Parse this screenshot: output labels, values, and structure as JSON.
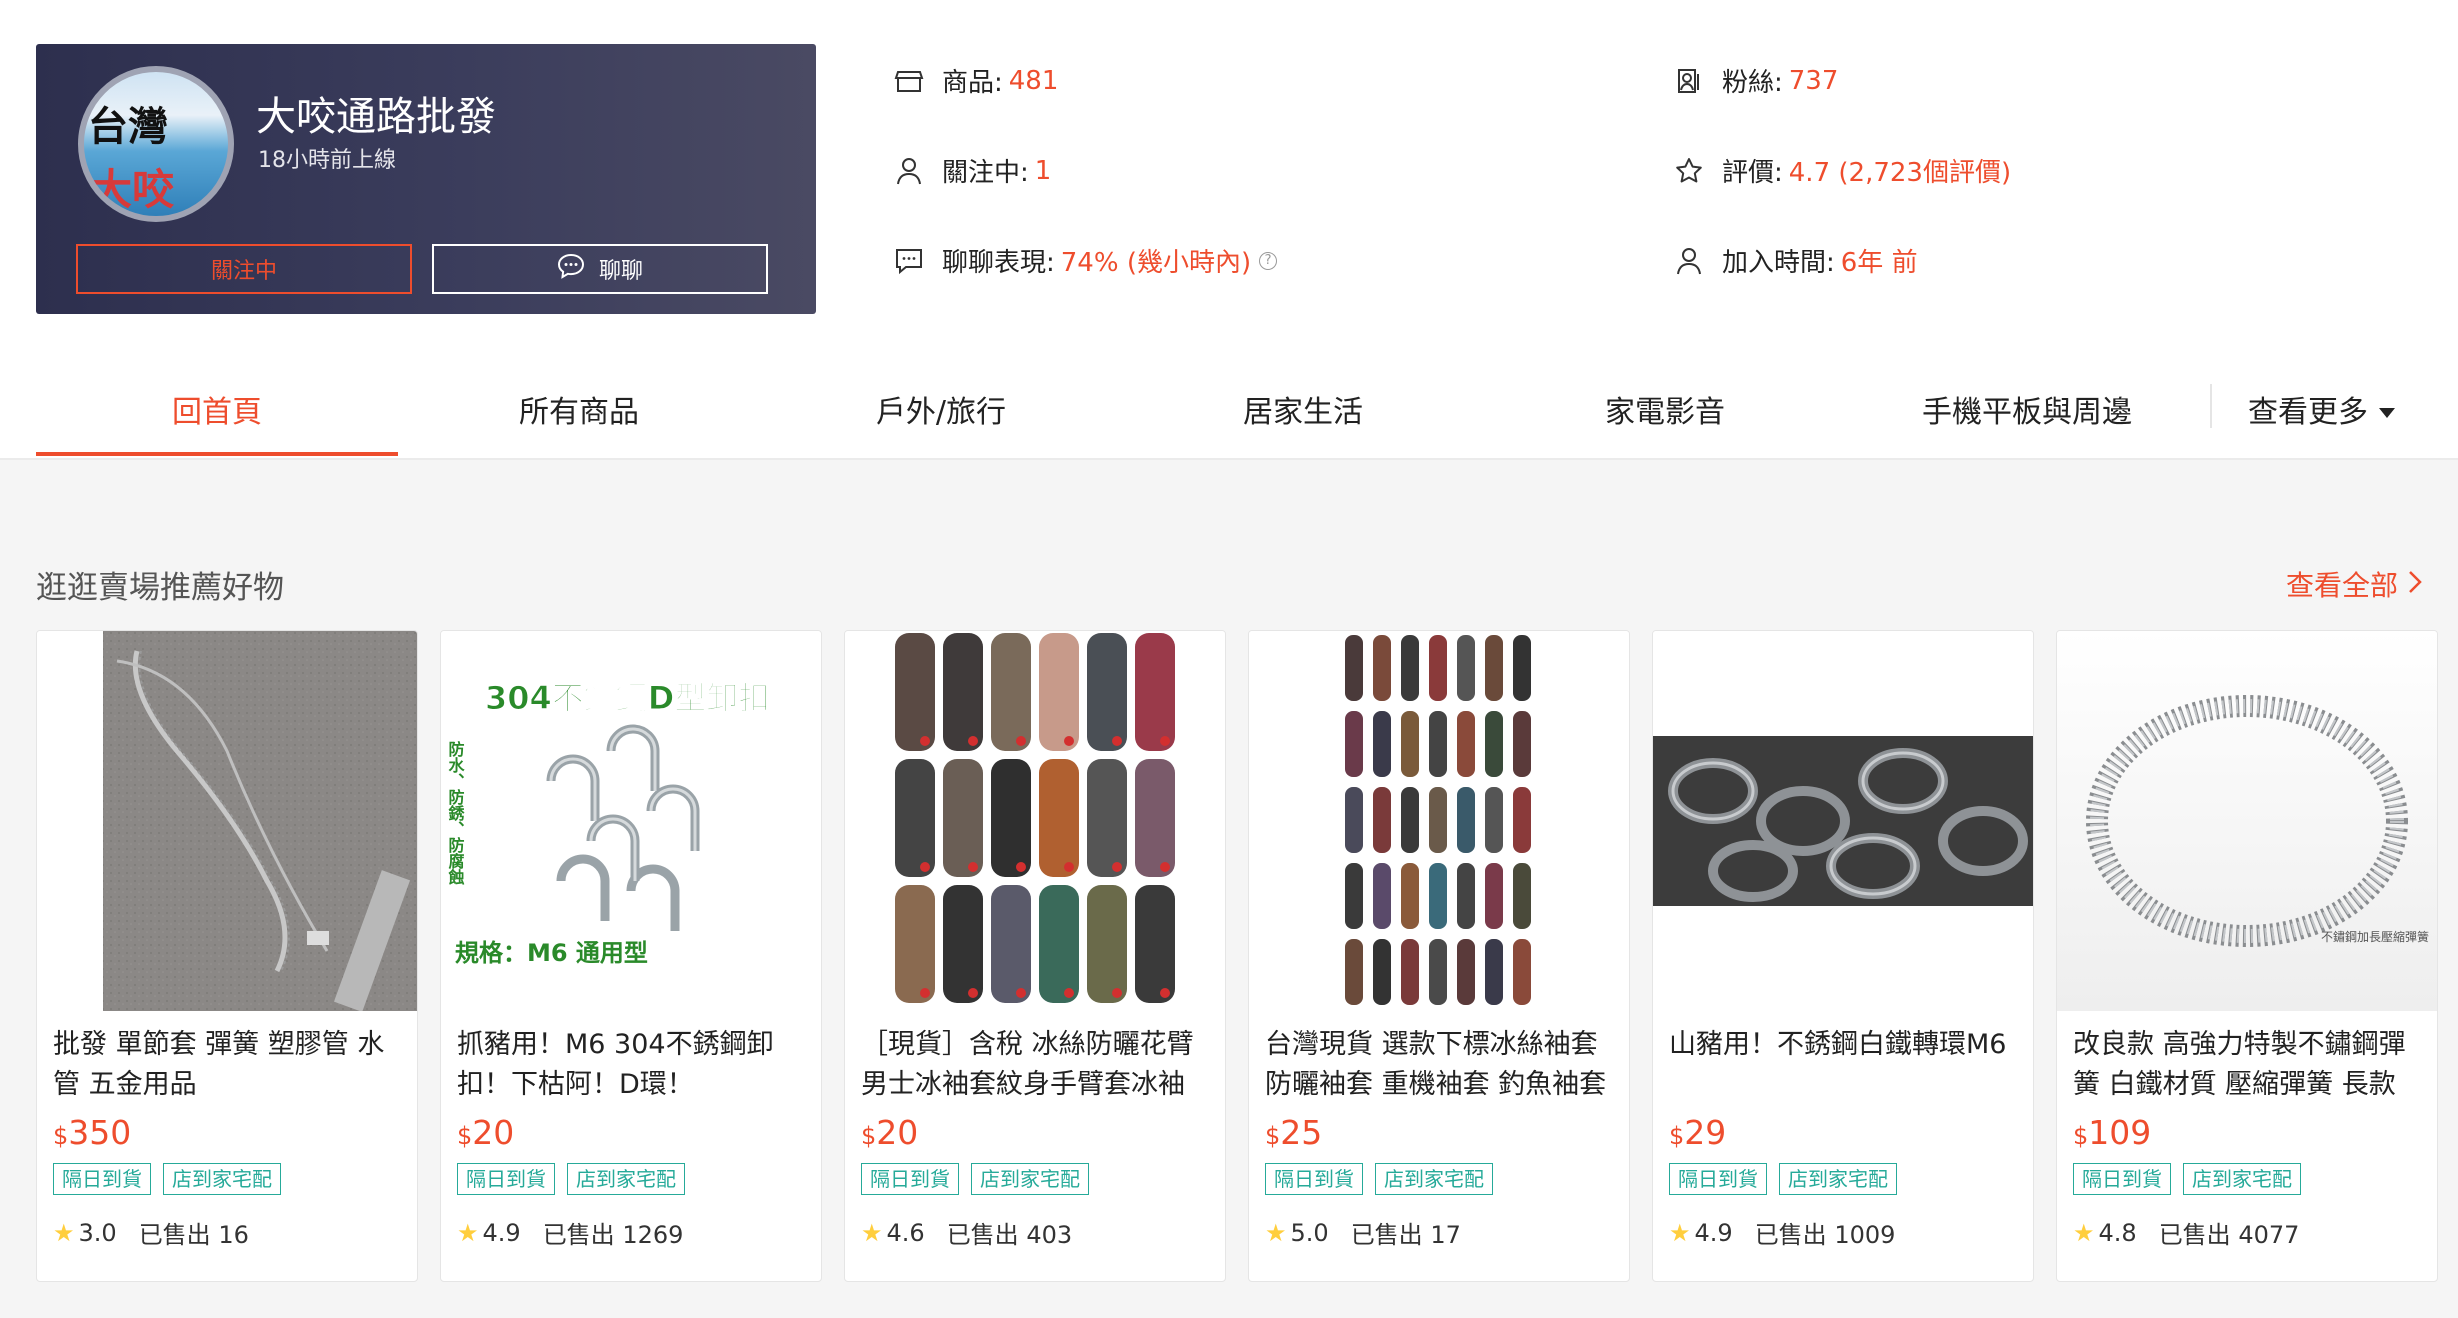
{
  "shop": {
    "avatar_text_top": "台灣",
    "avatar_text_bottom": "大咬",
    "name": "大咬通路批發",
    "online_status": "18小時前上線",
    "follow_button": "關注中",
    "chat_button": "聊聊"
  },
  "stats": {
    "products": {
      "label": "商品:",
      "value": "481",
      "icon": "store-icon"
    },
    "following": {
      "label": "關注中:",
      "value": "1",
      "icon": "person-icon"
    },
    "chat_performance": {
      "label": "聊聊表現:",
      "value": "74% (幾小時內)",
      "icon": "chat-icon"
    },
    "followers": {
      "label": "粉絲:",
      "value": "737",
      "icon": "followers-icon"
    },
    "rating": {
      "label": "評價:",
      "value": "4.7 (2,723個評價)",
      "icon": "star-outline-icon"
    },
    "joined": {
      "label": "加入時間:",
      "value": "6年 前",
      "icon": "person-icon"
    }
  },
  "tabs": [
    {
      "label": "回首頁",
      "active": true
    },
    {
      "label": "所有商品"
    },
    {
      "label": "戶外/旅行"
    },
    {
      "label": "居家生活"
    },
    {
      "label": "家電影音"
    },
    {
      "label": "手機平板與周邊"
    }
  ],
  "tab_more": "查看更多",
  "section": {
    "title": "逛逛賣場推薦好物",
    "see_all": "查看全部"
  },
  "tag_labels": [
    "隔日到貨",
    "店到家宅配"
  ],
  "products": [
    {
      "title": "批發 單節套 彈簧 塑膠管 水管 五金用品",
      "currency": "$",
      "price": "350",
      "rating": "3.0",
      "sold": "已售出 16"
    },
    {
      "title": "抓豬用！M6 304不銹鋼卸扣！下枯阿！D環！",
      "currency": "$",
      "price": "20",
      "rating": "4.9",
      "sold": "已售出 1269",
      "img_text_top": "304不鏽鋼D型卸扣",
      "img_text_bottom": "規格：M6 通用型",
      "img_text_side": "防水、防銹、防腐蝕"
    },
    {
      "title": "［現貨］含稅 冰絲防曬花臂男士冰袖套紋身手臂套冰袖",
      "currency": "$",
      "price": "20",
      "rating": "4.6",
      "sold": "已售出 403"
    },
    {
      "title": "台灣現貨 選款下標冰絲袖套防曬袖套 重機袖套 釣魚袖套",
      "currency": "$",
      "price": "25",
      "rating": "5.0",
      "sold": "已售出 17"
    },
    {
      "title": "山豬用！不銹鋼白鐵轉環M6",
      "currency": "$",
      "price": "29",
      "rating": "4.9",
      "sold": "已售出 1009"
    },
    {
      "title": "改良款 高強力特製不鏽鋼彈簧 白鐵材質 壓縮彈簧 長款",
      "currency": "$",
      "price": "109",
      "rating": "4.8",
      "sold": "已售出 4077",
      "img_caption": "不鏽鋼加長壓縮彈簧"
    }
  ],
  "colors": {
    "accent": "#ee4d2d",
    "tag": "#26aa99",
    "star": "#ffce3d",
    "shop_card_bg": "#2d2f4e"
  }
}
